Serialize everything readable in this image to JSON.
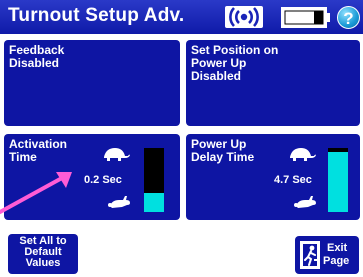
{
  "header": {
    "title": "Turnout Setup Adv.",
    "signal_icon": "signal-waves-icon",
    "battery_icon": "battery-icon",
    "help_label": "?"
  },
  "panels": {
    "feedback": {
      "line1": "Feedback",
      "line2": "Disabled"
    },
    "set_position": {
      "line1": "Set Position on",
      "line2": "Power Up",
      "line3": "Disabled"
    },
    "activation": {
      "line1": "Activation",
      "line2": "Time",
      "value": "0.2 Sec",
      "level": 0.3
    },
    "power_up_delay": {
      "line1": "Power Up",
      "line2": "Delay Time",
      "value": "4.7 Sec",
      "level": 0.94
    }
  },
  "buttons": {
    "set_defaults": {
      "line1": "Set All to",
      "line2": "Default",
      "line3": "Values"
    },
    "exit": {
      "line1": "Exit",
      "line2": "Page"
    }
  },
  "annotation": {
    "color": "#ff5cd6"
  },
  "colors": {
    "panel": "#0e15a3",
    "header": "#1a24b8",
    "bar_fill": "#00e0e0"
  }
}
